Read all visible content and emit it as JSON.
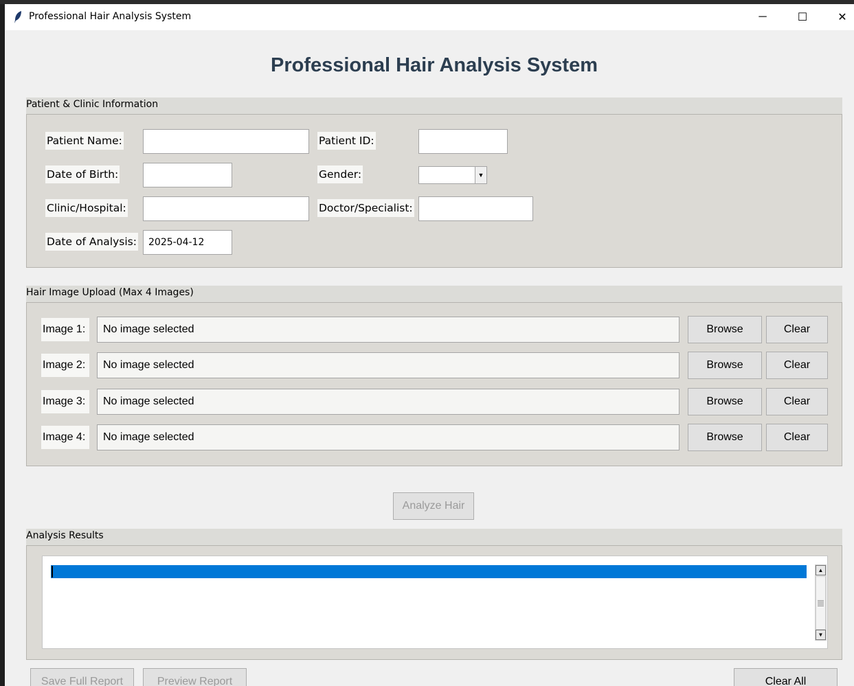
{
  "window": {
    "title": "Professional Hair Analysis System",
    "controls": {
      "minimize": "─",
      "maximize": "☐",
      "close": "✕"
    }
  },
  "header": {
    "title": "Professional Hair Analysis System"
  },
  "patient_section": {
    "label": "Patient & Clinic Information",
    "fields": {
      "patient_name": {
        "label": "Patient Name:",
        "value": ""
      },
      "patient_id": {
        "label": "Patient ID:",
        "value": ""
      },
      "date_of_birth": {
        "label": "Date of Birth:",
        "value": ""
      },
      "gender": {
        "label": "Gender:",
        "value": ""
      },
      "clinic": {
        "label": "Clinic/Hospital:",
        "value": ""
      },
      "doctor": {
        "label": "Doctor/Specialist:",
        "value": ""
      },
      "date_of_analysis": {
        "label": "Date of Analysis:",
        "value": "2025-04-12"
      }
    }
  },
  "upload_section": {
    "label": "Hair Image Upload (Max 4 Images)",
    "images": [
      {
        "label": "Image 1:",
        "value": "No image selected",
        "browse": "Browse",
        "clear": "Clear"
      },
      {
        "label": "Image 2:",
        "value": "No image selected",
        "browse": "Browse",
        "clear": "Clear"
      },
      {
        "label": "Image 3:",
        "value": "No image selected",
        "browse": "Browse",
        "clear": "Clear"
      },
      {
        "label": "Image 4:",
        "value": "No image selected",
        "browse": "Browse",
        "clear": "Clear"
      }
    ]
  },
  "analyze_button": "Analyze Hair",
  "results_section": {
    "label": "Analysis Results",
    "text": ""
  },
  "footer": {
    "save_report": "Save Full Report",
    "preview_report": "Preview Report",
    "clear_all": "Clear All"
  },
  "colors": {
    "title_text": "#2c3e50",
    "selection": "#0078d7"
  }
}
